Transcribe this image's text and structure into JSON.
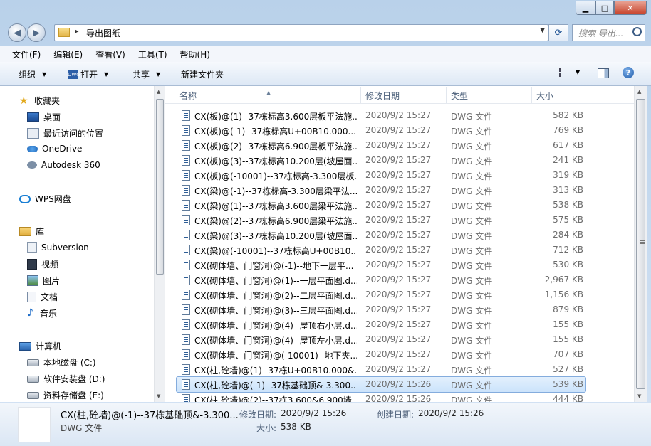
{
  "address": {
    "path": "导出图纸"
  },
  "search": {
    "placeholder": "搜索 导出..."
  },
  "menu": [
    "文件(F)",
    "编辑(E)",
    "查看(V)",
    "工具(T)",
    "帮助(H)"
  ],
  "toolbar": {
    "organize": "组织",
    "open": "打开",
    "share": "共享",
    "new_folder": "新建文件夹"
  },
  "nav": {
    "favorites": "收藏夹",
    "desktop": "桌面",
    "recent": "最近访问的位置",
    "onedrive": "OneDrive",
    "autodesk": "Autodesk 360",
    "wps": "WPS网盘",
    "libraries": "库",
    "subversion": "Subversion",
    "video": "视频",
    "pictures": "图片",
    "documents": "文档",
    "music": "音乐",
    "computer": "计算机",
    "drive_c": "本地磁盘 (C:)",
    "drive_d": "软件安装盘 (D:)",
    "drive_e": "资料存储盘 (E:)"
  },
  "columns": {
    "name": "名称",
    "date": "修改日期",
    "type": "类型",
    "size": "大小"
  },
  "files": [
    {
      "name": "CX(板)@(1)--37栋标高3.600层板平法施...",
      "date": "2020/9/2 15:27",
      "type": "DWG 文件",
      "size": "582 KB"
    },
    {
      "name": "CX(板)@(-1)--37栋标高U+00B10.000...",
      "date": "2020/9/2 15:27",
      "type": "DWG 文件",
      "size": "769 KB"
    },
    {
      "name": "CX(板)@(2)--37栋标高6.900层板平法施...",
      "date": "2020/9/2 15:27",
      "type": "DWG 文件",
      "size": "617 KB"
    },
    {
      "name": "CX(板)@(3)--37栋标高10.200层(坡屋面...",
      "date": "2020/9/2 15:27",
      "type": "DWG 文件",
      "size": "241 KB"
    },
    {
      "name": "CX(板)@(-10001)--37栋标高-3.300层板...",
      "date": "2020/9/2 15:27",
      "type": "DWG 文件",
      "size": "319 KB"
    },
    {
      "name": "CX(梁)@(-1)--37栋标高-3.300层梁平法...",
      "date": "2020/9/2 15:27",
      "type": "DWG 文件",
      "size": "313 KB"
    },
    {
      "name": "CX(梁)@(1)--37栋标高3.600层梁平法施...",
      "date": "2020/9/2 15:27",
      "type": "DWG 文件",
      "size": "538 KB"
    },
    {
      "name": "CX(梁)@(2)--37栋标高6.900层梁平法施...",
      "date": "2020/9/2 15:27",
      "type": "DWG 文件",
      "size": "575 KB"
    },
    {
      "name": "CX(梁)@(3)--37栋标高10.200层(坡屋面...",
      "date": "2020/9/2 15:27",
      "type": "DWG 文件",
      "size": "284 KB"
    },
    {
      "name": "CX(梁)@(-10001)--37栋标高U+00B10...",
      "date": "2020/9/2 15:27",
      "type": "DWG 文件",
      "size": "712 KB"
    },
    {
      "name": "CX(砌体墙、门窗洞)@(-1)--地下一层平...",
      "date": "2020/9/2 15:27",
      "type": "DWG 文件",
      "size": "530 KB"
    },
    {
      "name": "CX(砌体墙、门窗洞)@(1)--一层平面图.d...",
      "date": "2020/9/2 15:27",
      "type": "DWG 文件",
      "size": "2,967 KB"
    },
    {
      "name": "CX(砌体墙、门窗洞)@(2)--二层平面图.d...",
      "date": "2020/9/2 15:27",
      "type": "DWG 文件",
      "size": "1,156 KB"
    },
    {
      "name": "CX(砌体墙、门窗洞)@(3)--三层平面图.d...",
      "date": "2020/9/2 15:27",
      "type": "DWG 文件",
      "size": "879 KB"
    },
    {
      "name": "CX(砌体墙、门窗洞)@(4)--屋顶右小层.d...",
      "date": "2020/9/2 15:27",
      "type": "DWG 文件",
      "size": "155 KB"
    },
    {
      "name": "CX(砌体墙、门窗洞)@(4)--屋顶左小层.d...",
      "date": "2020/9/2 15:27",
      "type": "DWG 文件",
      "size": "155 KB"
    },
    {
      "name": "CX(砌体墙、门窗洞)@(-10001)--地下夹...",
      "date": "2020/9/2 15:27",
      "type": "DWG 文件",
      "size": "707 KB"
    },
    {
      "name": "CX(柱,砼墙)@(1)--37栋U+00B10.000&...",
      "date": "2020/9/2 15:27",
      "type": "DWG 文件",
      "size": "527 KB"
    },
    {
      "name": "CX(柱,砼墙)@(-1)--37栋基础顶&-3.300...",
      "date": "2020/9/2 15:26",
      "type": "DWG 文件",
      "size": "539 KB",
      "selected": true
    },
    {
      "name": "CX(柱,砼墙)@(2)--37栋3.600&6.900墙...",
      "date": "2020/9/2 15:26",
      "type": "DWG 文件",
      "size": "444 KB"
    }
  ],
  "details": {
    "name": "CX(柱,砼墙)@(-1)--37栋基础顶&-3.300...",
    "type": "DWG 文件",
    "modified_label": "修改日期:",
    "modified": "2020/9/2 15:26",
    "created_label": "创建日期:",
    "created": "2020/9/2 15:26",
    "size_label": "大小:",
    "size": "538 KB"
  }
}
